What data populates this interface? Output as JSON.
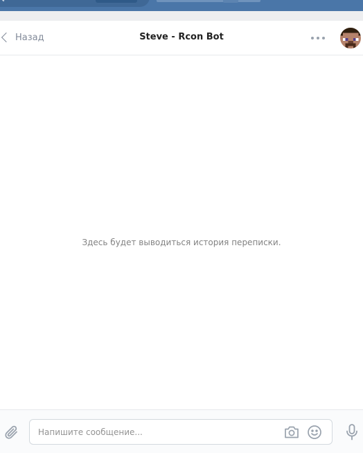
{
  "header": {
    "back_label": "Назад",
    "title": "Steve - Rcon Bot"
  },
  "history": {
    "empty_text": "Здесь будет выводиться история переписки."
  },
  "composer": {
    "placeholder": "Напишите сообщение..."
  },
  "icons": {
    "back": "chevron-left-icon",
    "more": "more-horizontal-icon",
    "attach": "paperclip-icon",
    "camera": "camera-icon",
    "smile": "smile-icon",
    "mic": "microphone-icon"
  },
  "colors": {
    "vk_blue": "#4a76a8",
    "muted_text": "#828a99",
    "icon_gray": "#99a2ad"
  }
}
